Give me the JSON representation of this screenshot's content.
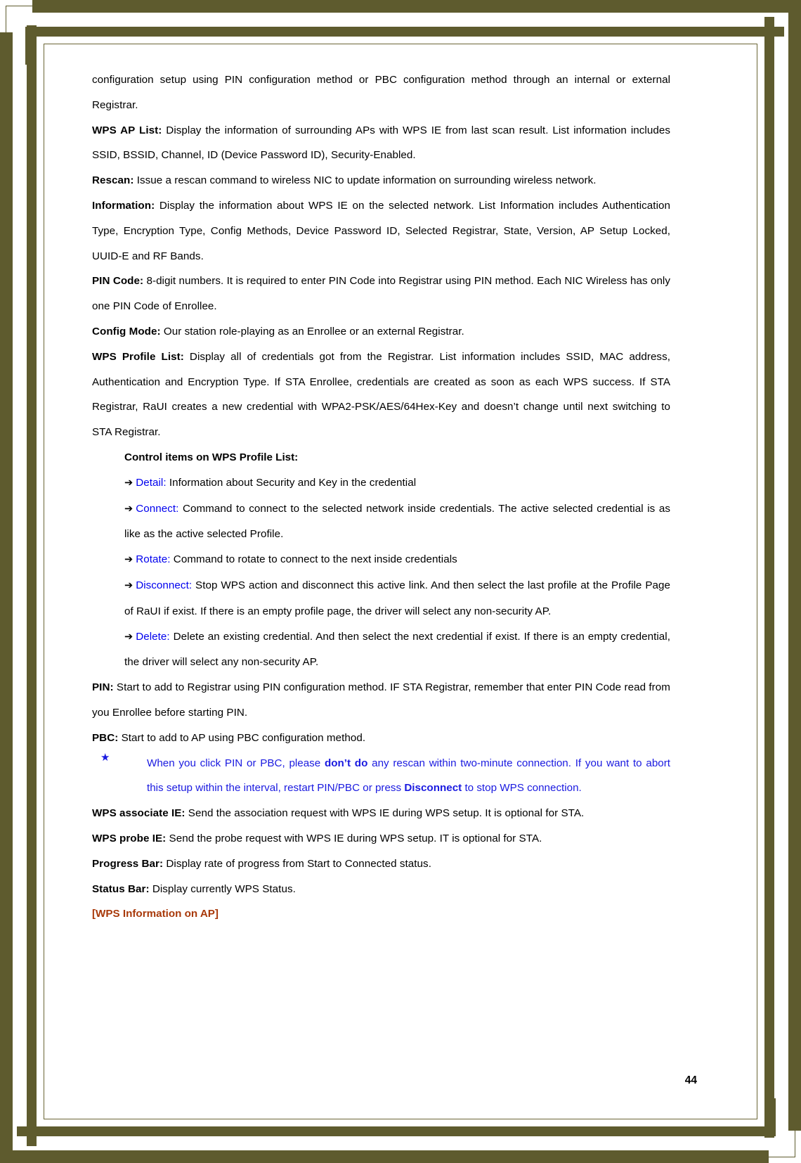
{
  "page": {
    "number": "44",
    "border_color": "#5E5B2E",
    "blue_color": "#1A1AE0",
    "keyword_blue": "#0000EE",
    "red_heading_color": "#A8390A"
  },
  "body": {
    "continued_paragraph": "configuration setup using PIN configuration method or PBC configuration method through an internal or external Registrar.",
    "entries": [
      {
        "label": "WPS AP List:",
        "text": " Display the information of surrounding APs with WPS IE from last scan result. List information includes SSID, BSSID, Channel, ID (Device Password ID), Security-Enabled."
      },
      {
        "label": "Rescan:",
        "text": " Issue a rescan command to wireless NIC to update information on surrounding wireless network."
      },
      {
        "label": "Information:",
        "text": " Display the information about WPS IE on the selected network. List Information includes Authentication Type, Encryption Type, Config Methods, Device Password ID, Selected Registrar, State, Version, AP Setup Locked, UUID-E and RF Bands."
      },
      {
        "label": "PIN Code:",
        "text": " 8-digit numbers. It is required to enter PIN Code into Registrar using PIN method. Each NIC Wireless has only one PIN Code of Enrollee."
      },
      {
        "label": "Config Mode:",
        "text": " Our station role-playing as an Enrollee or an external Registrar."
      },
      {
        "label": "WPS Profile List:",
        "text": " Display all of credentials got from the Registrar. List information includes SSID, MAC address, Authentication and Encryption Type. If STA Enrollee, credentials are created as soon as each WPS success. If STA Registrar, RaUI creates a new credential with WPA2-PSK/AES/64Hex-Key and doesn’t change until next switching to STA Registrar."
      }
    ],
    "control_items_heading": "Control items on WPS Profile List:",
    "control_items": [
      {
        "arrow": "➔",
        "keyword": "Detail:",
        "text": " Information about Security and Key in the credential"
      },
      {
        "arrow": "➔",
        "keyword": "Connect:",
        "text": " Command to connect to the selected network inside credentials. The active selected credential is as like as the active selected Profile."
      },
      {
        "arrow": "➔",
        "keyword": "Rotate:",
        "text": " Command to rotate to connect to the next inside credentials"
      },
      {
        "arrow": "➔",
        "keyword": "Disconnect:",
        "text": " Stop WPS action and disconnect this active link. And then select the last profile at the Profile Page of RaUI if exist. If there is an empty profile page, the driver will select any non-security AP."
      },
      {
        "arrow": "➔",
        "keyword": "Delete:",
        "text": " Delete an existing credential. And then select the next credential if exist. If there is an empty credential, the driver will select any non-security AP."
      }
    ],
    "entries_2": [
      {
        "label": "PIN:",
        "text": " Start to add to Registrar using PIN configuration method. IF STA Registrar, remember that enter PIN Code read from you Enrollee before starting PIN."
      },
      {
        "label": "PBC:",
        "text": " Start to add to AP using PBC configuration method."
      }
    ],
    "note": {
      "bullet": "★",
      "part1": "When you click PIN or PBC, please ",
      "bold1": "don’t do",
      "part2": " any rescan within two-minute connection. If you want to abort this setup within the interval, restart PIN/PBC or press ",
      "bold2": "Disconnect",
      "part3": " to stop WPS connection."
    },
    "entries_3": [
      {
        "label": "WPS associate IE:",
        "text": " Send the association request with WPS IE during WPS setup. It is optional for STA."
      },
      {
        "label": "WPS probe IE:",
        "text": " Send the probe request with WPS IE during WPS setup. IT is optional for STA."
      },
      {
        "label": "Progress Bar:",
        "text": " Display rate of progress from Start to Connected status."
      },
      {
        "label": "Status Bar:",
        "text": " Display currently WPS Status."
      }
    ],
    "red_heading": "[WPS Information on AP]"
  }
}
